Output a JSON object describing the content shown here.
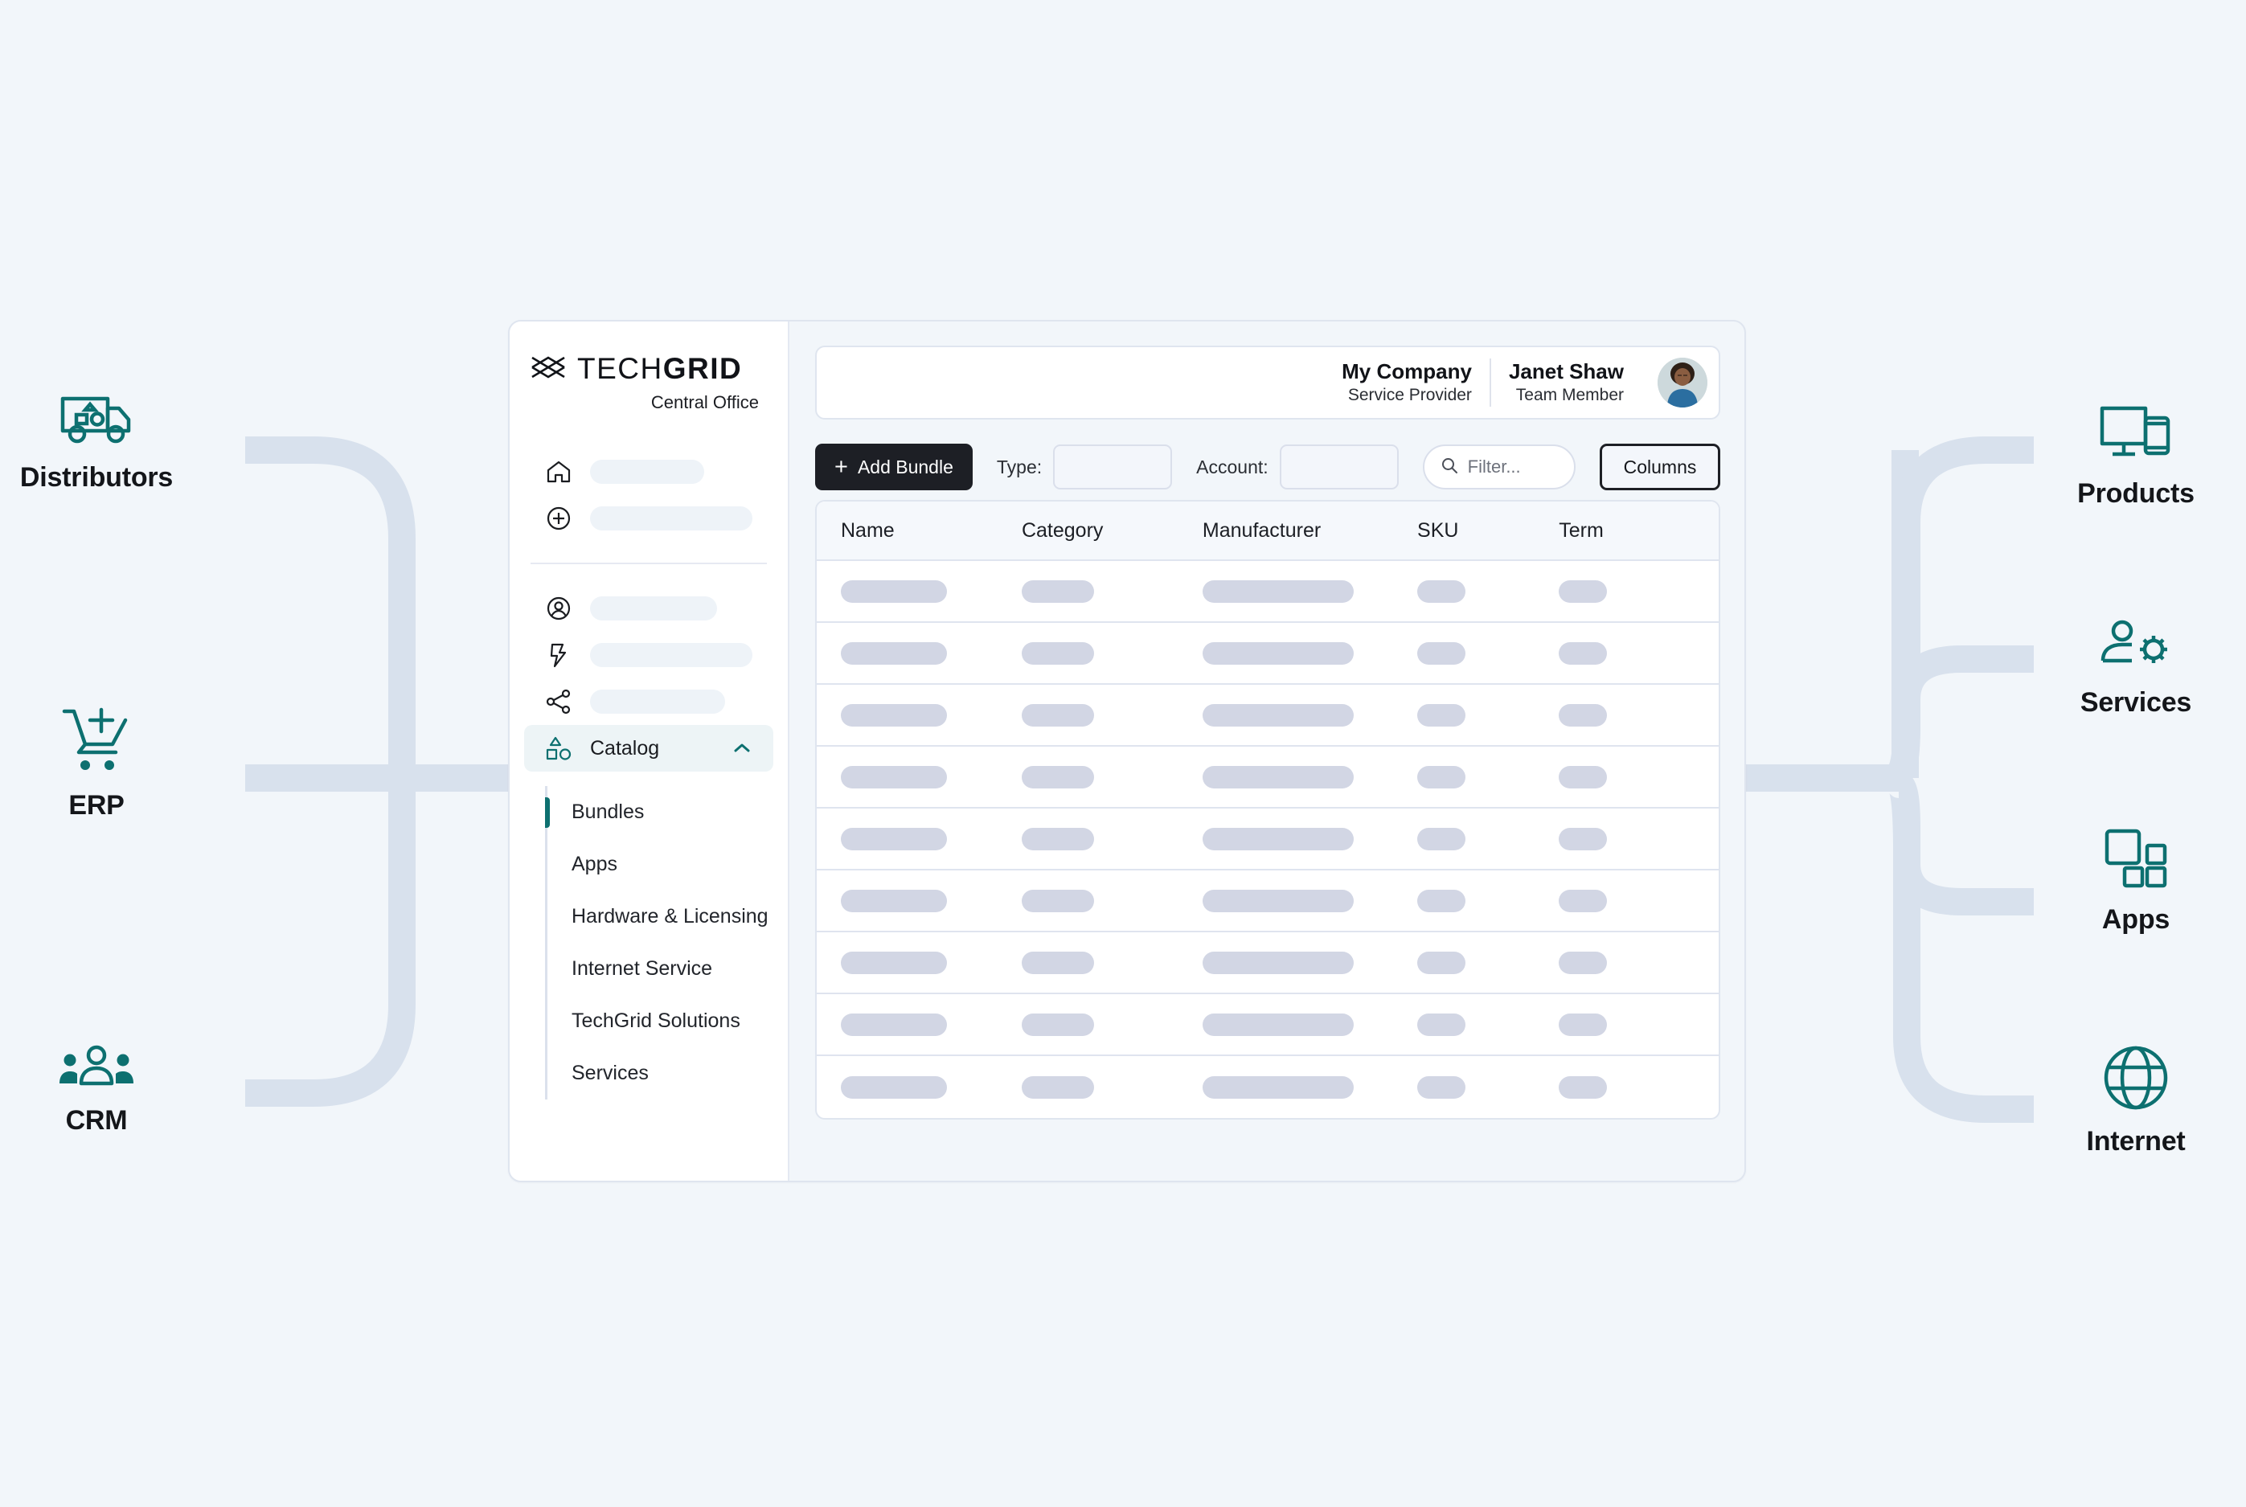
{
  "theme": {
    "page_background": "#f2f6fa",
    "accent_teal": "#0d7070",
    "connector": "#d6dfeb",
    "ink": "#111318",
    "skeleton_pill": "#d2d6e4",
    "skeleton_nav": "#eef3f8",
    "dark_button": "#1d1f25"
  },
  "left_flow": [
    {
      "id": "distributors",
      "label": "Distributors",
      "icon": "delivery-truck-icon"
    },
    {
      "id": "erp",
      "label": "ERP",
      "icon": "shopping-cart-plus-icon"
    },
    {
      "id": "crm",
      "label": "CRM",
      "icon": "people-group-icon"
    }
  ],
  "right_flow": [
    {
      "id": "products",
      "label": "Products",
      "icon": "monitor-phone-icon"
    },
    {
      "id": "services",
      "label": "Services",
      "icon": "person-gear-icon"
    },
    {
      "id": "apps",
      "label": "Apps",
      "icon": "squares-grid-icon"
    },
    {
      "id": "internet",
      "label": "Internet",
      "icon": "globe-icon"
    }
  ],
  "app": {
    "sidebar": {
      "brand": {
        "name_light": "TECH",
        "name_bold": "GRID",
        "logo_icon": "techgrid-x-logo-icon",
        "subtitle": "Central Office"
      },
      "nav_items": [
        {
          "icon": "home-icon",
          "label": "",
          "skeleton_width": 142
        },
        {
          "icon": "plus-circle-icon",
          "label": "",
          "skeleton_width": 212
        },
        {
          "icon": "account-circle-icon",
          "label": "",
          "skeleton_width": 158
        },
        {
          "icon": "lightning-bolt-icon",
          "label": "",
          "skeleton_width": 202
        },
        {
          "icon": "share-nodes-icon",
          "label": "",
          "skeleton_width": 168
        }
      ],
      "catalog": {
        "label": "Catalog",
        "icon": "shapes-icon",
        "chevron": "chevron-up-icon",
        "expanded": true,
        "items": [
          {
            "label": "Bundles",
            "selected": true
          },
          {
            "label": "Apps",
            "selected": false
          },
          {
            "label": "Hardware & Licensing",
            "selected": false
          },
          {
            "label": "Internet Service",
            "selected": false
          },
          {
            "label": "TechGrid Solutions",
            "selected": false
          },
          {
            "label": "Services",
            "selected": false
          }
        ]
      }
    },
    "topbar": {
      "company_name": "My Company",
      "company_role": "Service Provider",
      "user_name": "Janet Shaw",
      "user_role": "Team Member",
      "avatar_alt": "user-avatar"
    },
    "toolbar": {
      "add_bundle_label": "Add Bundle",
      "add_bundle_icon": "plus-icon",
      "type_label": "Type:",
      "type_value": "",
      "account_label": "Account:",
      "account_value": "",
      "filter_placeholder": "Filter...",
      "filter_value": "",
      "filter_icon": "search-icon",
      "columns_label": "Columns"
    },
    "table": {
      "columns": [
        "Name",
        "Category",
        "Manufacturer",
        "SKU",
        "Term"
      ],
      "rows": [
        {
          "Name": "",
          "Category": "",
          "Manufacturer": "",
          "SKU": "",
          "Term": ""
        },
        {
          "Name": "",
          "Category": "",
          "Manufacturer": "",
          "SKU": "",
          "Term": ""
        },
        {
          "Name": "",
          "Category": "",
          "Manufacturer": "",
          "SKU": "",
          "Term": ""
        },
        {
          "Name": "",
          "Category": "",
          "Manufacturer": "",
          "SKU": "",
          "Term": ""
        },
        {
          "Name": "",
          "Category": "",
          "Manufacturer": "",
          "SKU": "",
          "Term": ""
        },
        {
          "Name": "",
          "Category": "",
          "Manufacturer": "",
          "SKU": "",
          "Term": ""
        },
        {
          "Name": "",
          "Category": "",
          "Manufacturer": "",
          "SKU": "",
          "Term": ""
        },
        {
          "Name": "",
          "Category": "",
          "Manufacturer": "",
          "SKU": "",
          "Term": ""
        },
        {
          "Name": "",
          "Category": "",
          "Manufacturer": "",
          "SKU": "",
          "Term": ""
        }
      ],
      "row_count": 9,
      "content_state": "loading-skeleton"
    }
  }
}
